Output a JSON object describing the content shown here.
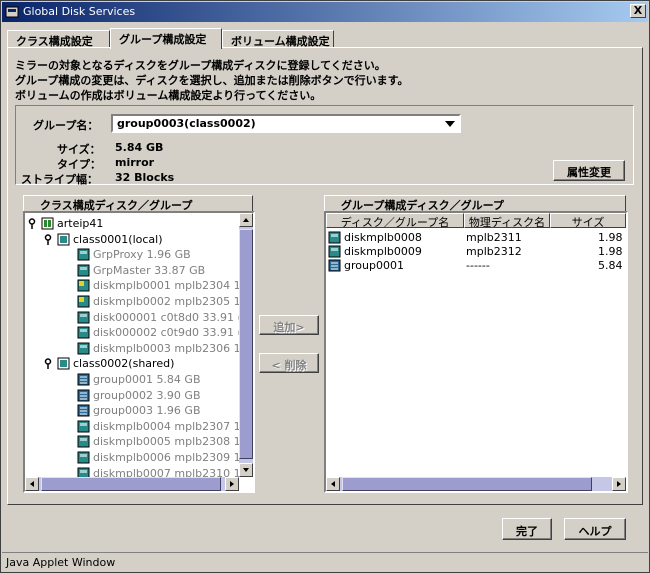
{
  "window": {
    "title": "Global Disk Services",
    "close_label": "X"
  },
  "tabs": [
    {
      "label": "クラス構成設定",
      "active": false
    },
    {
      "label": "グループ構成設定",
      "active": true
    },
    {
      "label": "ボリューム構成設定",
      "active": false
    }
  ],
  "description": [
    "ミラーの対象となるディスクをグループ構成ディスクに登録してください。",
    "グループ構成の変更は、ディスクを選択し、追加または削除ボタンで行います。",
    "ボリュームの作成はボリューム構成設定より行ってください。"
  ],
  "group": {
    "name_label": "グループ名：",
    "name_value": "group0003(class0002)",
    "size_label": "サイズ：",
    "size_value": "5.84 GB",
    "type_label": "タイプ：",
    "type_value": "mirror",
    "stripe_label": "ストライプ幅：",
    "stripe_value": "32 Blocks",
    "change_attr_label": "属性変更"
  },
  "left_panel": {
    "title": "クラス構成ディスク／グループ",
    "tree": [
      {
        "text": "arteip41",
        "level": 0,
        "grey": false,
        "icon": "host-icon"
      },
      {
        "text": "class0001(local)",
        "level": 1,
        "grey": false,
        "icon": "class-icon"
      },
      {
        "text": "GrpProxy   1.96 GB",
        "level": 2,
        "grey": true,
        "icon": "disk-icon"
      },
      {
        "text": "GrpMaster   33.87 GB",
        "level": 2,
        "grey": true,
        "icon": "disk-icon"
      },
      {
        "text": "diskmplb0001   mplb2304   1",
        "level": 2,
        "grey": true,
        "icon": "disk-warn-icon"
      },
      {
        "text": "diskmplb0002   mplb2305   1",
        "level": 2,
        "grey": true,
        "icon": "disk-warn-icon"
      },
      {
        "text": "disk000001   c0t8d0   33.91 (",
        "level": 2,
        "grey": true,
        "icon": "disk-icon"
      },
      {
        "text": "disk000002   c0t9d0   33.91 (",
        "level": 2,
        "grey": true,
        "icon": "disk-icon"
      },
      {
        "text": "diskmplb0003   mplb2306   1",
        "level": 2,
        "grey": true,
        "icon": "disk-icon"
      },
      {
        "text": "class0002(shared)",
        "level": 1,
        "grey": false,
        "icon": "class-icon"
      },
      {
        "text": "group0001   5.84 GB",
        "level": 2,
        "grey": true,
        "icon": "group-icon"
      },
      {
        "text": "group0002   3.90 GB",
        "level": 2,
        "grey": true,
        "icon": "group-icon"
      },
      {
        "text": "group0003   1.96 GB",
        "level": 2,
        "grey": true,
        "icon": "group-icon"
      },
      {
        "text": "diskmplb0004   mplb2307   1",
        "level": 2,
        "grey": true,
        "icon": "disk-icon"
      },
      {
        "text": "diskmplb0005   mplb2308   1",
        "level": 2,
        "grey": true,
        "icon": "disk-icon"
      },
      {
        "text": "diskmplb0006   mplb2309   1",
        "level": 2,
        "grey": true,
        "icon": "disk-icon"
      },
      {
        "text": "diskmplb0007   mplb2310   1",
        "level": 2,
        "grey": true,
        "icon": "disk-icon"
      }
    ]
  },
  "middle": {
    "add_label": "追加>",
    "remove_label": "< 削除"
  },
  "right_panel": {
    "title": "グループ構成ディスク／グループ",
    "columns": [
      "ディスク／グループ名",
      "物理ディスク名",
      "サイズ"
    ],
    "rows": [
      {
        "name": "diskmplb0008",
        "physical": "mplb2311",
        "size": "1.98 (",
        "icon": "disk-icon"
      },
      {
        "name": "diskmplb0009",
        "physical": "mplb2312",
        "size": "1.98 (",
        "icon": "disk-icon"
      },
      {
        "name": "group0001",
        "physical": "------",
        "size": "5.84 (",
        "icon": "group-icon"
      }
    ]
  },
  "footer": {
    "ok_label": "完了",
    "help_label": "ヘルプ"
  },
  "status": {
    "text": "Java Applet Window"
  }
}
